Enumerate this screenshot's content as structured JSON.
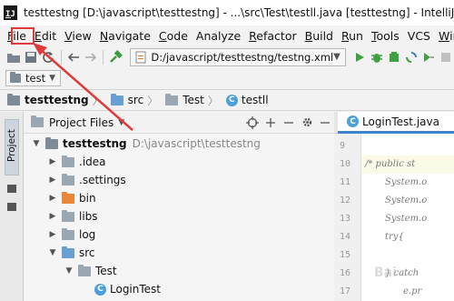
{
  "window": {
    "title": "testtestng [D:\\javascript\\testtestng] - ...\\src\\Test\\testll.java [testtestng] - IntelliJ IDEA"
  },
  "menu": [
    {
      "label": "File",
      "mnemonic": "F",
      "rest": "ile"
    },
    {
      "label": "Edit",
      "mnemonic": "E",
      "rest": "dit"
    },
    {
      "label": "View",
      "mnemonic": "V",
      "rest": "iew"
    },
    {
      "label": "Navigate",
      "mnemonic": "N",
      "rest": "avigate"
    },
    {
      "label": "Code",
      "mnemonic": "C",
      "rest": "ode"
    },
    {
      "label": "Analyze",
      "mnemonic": "",
      "rest": "Analyze"
    },
    {
      "label": "Refactor",
      "mnemonic": "R",
      "rest": "efactor"
    },
    {
      "label": "Build",
      "mnemonic": "B",
      "rest": "uild"
    },
    {
      "label": "Run",
      "mnemonic": "R",
      "rest": "un"
    },
    {
      "label": "Tools",
      "mnemonic": "T",
      "rest": "ools"
    },
    {
      "label": "VCS",
      "mnemonic": "",
      "rest": "VCS"
    },
    {
      "label": "Win",
      "mnemonic": "W",
      "rest": "in"
    }
  ],
  "toolbar": {
    "path_combo": "D:/javascript/testtestng/testng.xml",
    "project_combo": "test"
  },
  "breadcrumbs": [
    "testtestng",
    "src",
    "Test",
    "testll"
  ],
  "side_strip": {
    "tab_label": "Project"
  },
  "project_panel": {
    "title": "Project Files",
    "tree": [
      {
        "label": "testtestng",
        "path": "D:\\javascript\\testtestng",
        "bold": true,
        "expanded": true,
        "level": 0,
        "icon": "folder-dark"
      },
      {
        "label": ".idea",
        "level": 1,
        "expanded": false,
        "icon": "folder"
      },
      {
        "label": ".settings",
        "level": 1,
        "expanded": false,
        "icon": "folder"
      },
      {
        "label": "bin",
        "level": 1,
        "expanded": false,
        "icon": "folder-orange"
      },
      {
        "label": "libs",
        "level": 1,
        "expanded": false,
        "icon": "folder"
      },
      {
        "label": "log",
        "level": 1,
        "expanded": false,
        "icon": "folder"
      },
      {
        "label": "src",
        "level": 1,
        "expanded": true,
        "icon": "folder-blue"
      },
      {
        "label": "Test",
        "level": 2,
        "expanded": true,
        "icon": "folder"
      },
      {
        "label": "LoginTest",
        "level": 3,
        "expanded": false,
        "icon": "class"
      }
    ]
  },
  "editor": {
    "tab_label": "LoginTest.java",
    "line_numbers": [
      "9",
      "10",
      "11",
      "12",
      "13",
      "14",
      "15",
      "16",
      "17"
    ],
    "code_lines": [
      "/* public st",
      "System.o",
      "System.o",
      "System.o",
      "try{",
      "",
      "} catch",
      "e.pr",
      "Syst"
    ]
  },
  "watermark": "Bai"
}
